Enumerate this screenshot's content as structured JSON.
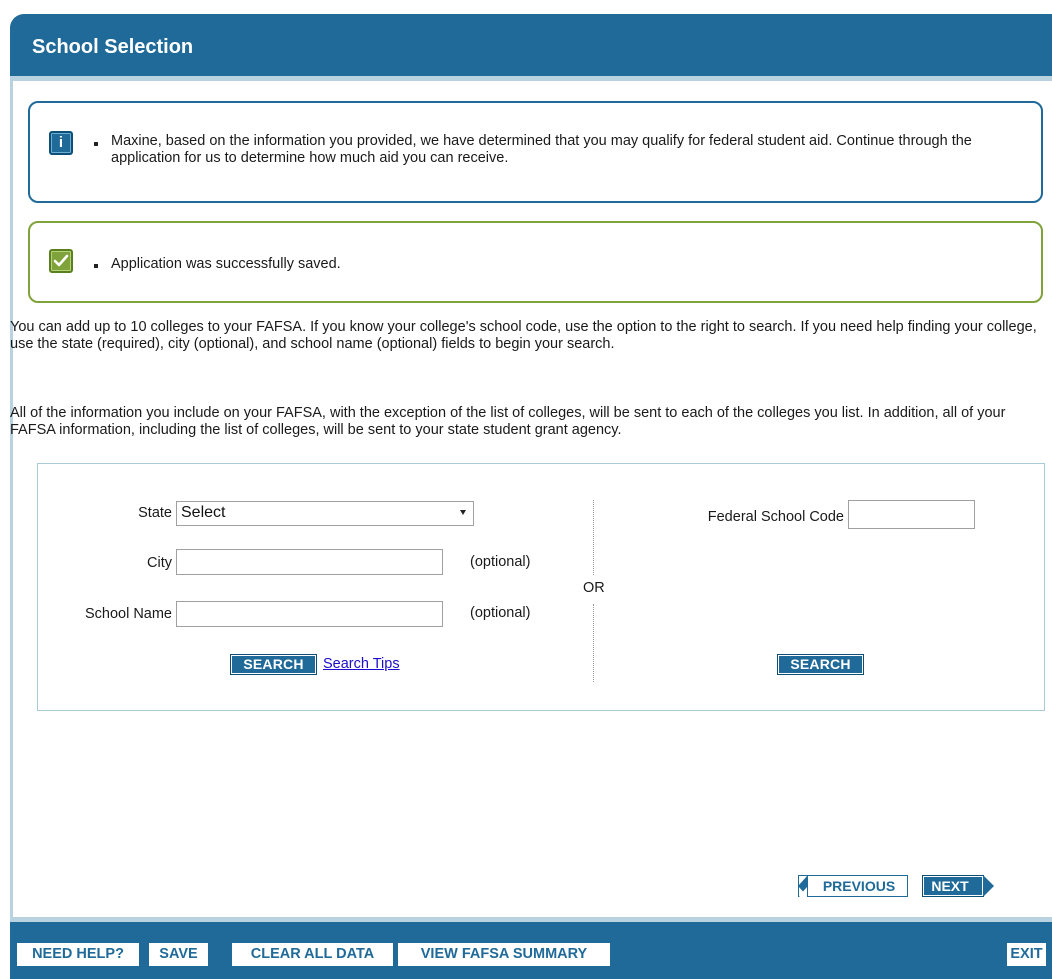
{
  "header": {
    "title": "School Selection"
  },
  "messages": {
    "info_text": "Maxine, based on the information you provided, we have determined that you may qualify for federal student aid. Continue through the application for us to determine how much aid you can receive.",
    "info_icon": "info-icon",
    "success_text": "Application was successfully saved.",
    "success_icon": "check-icon"
  },
  "intro": {
    "paragraph1": "You can add up to 10 colleges to your FAFSA. If you know your college's school code, use the option to the right to search. If you need help finding your college, use the state (required), city (optional), and school name (optional) fields to begin your search.",
    "paragraph2": "All of the information you include on your FAFSA, with the exception of the list of colleges, will be sent to each of the colleges you list. In addition, all of your FAFSA information, including the list of colleges, will be sent to your state student grant agency."
  },
  "search": {
    "state_label": "State",
    "state_selected": "Select",
    "city_label": "City",
    "city_value": "",
    "city_optional": "(optional)",
    "school_label": "School Name",
    "school_value": "",
    "school_optional": "(optional)",
    "search_button": "SEARCH",
    "search_tips": "Search Tips",
    "or_text": "OR",
    "code_label": "Federal School Code",
    "code_value": "",
    "code_search_button": "SEARCH"
  },
  "navigation": {
    "previous": "PREVIOUS",
    "next": "NEXT"
  },
  "footer": {
    "need_help": "NEED HELP?",
    "save": "SAVE",
    "clear_all": "CLEAR ALL DATA",
    "view_summary": "VIEW FAFSA SUMMARY",
    "exit": "EXIT"
  },
  "colors": {
    "primary": "#1f6a98",
    "success": "#7fa33a",
    "link": "#1a0dcc"
  }
}
